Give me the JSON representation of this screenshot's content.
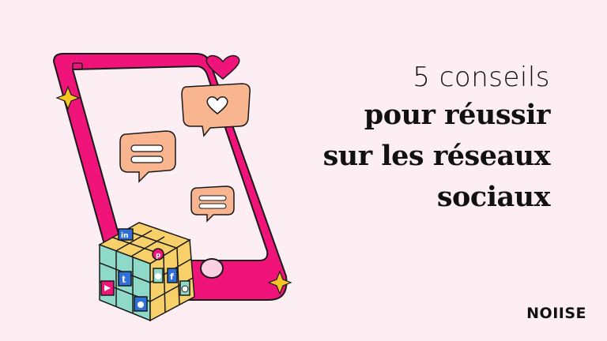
{
  "title": {
    "line1": "5 conseils",
    "line2": "pour réussir",
    "line3": "sur les réseaux",
    "line4": "sociaux"
  },
  "brand": {
    "logo": "NOIISE"
  },
  "icons": [
    "phone-icon",
    "heart-icon",
    "heart-bubble-icon",
    "chat-bubble-icon",
    "sparkle-icon",
    "rubiks-cube-icon",
    "linkedin-icon",
    "pinterest-icon",
    "tumblr-icon",
    "facebook-icon",
    "snapchat-icon",
    "whatsapp-icon",
    "twitter-icon",
    "youtube-icon"
  ],
  "colors": {
    "background": "#fdeef4",
    "accent": "#f0147a",
    "bubble": "#f8b58f",
    "text": "#111111"
  }
}
